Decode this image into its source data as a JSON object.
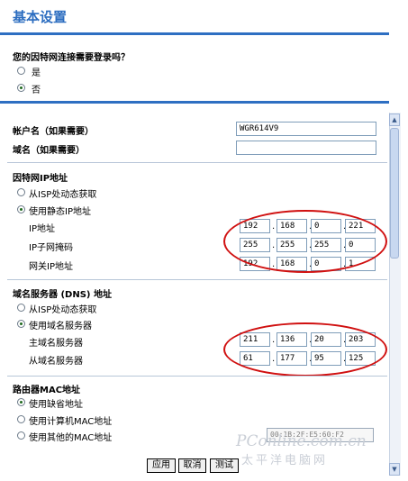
{
  "page": {
    "title": "基本设置"
  },
  "login": {
    "question": "您的因特网连接需要登录吗？",
    "yes": "是",
    "no": "否"
  },
  "account": {
    "account_label": "帐户名（如果需要）",
    "account_value": "WGR614V9",
    "domain_label": "域名（如果需要）",
    "domain_value": ""
  },
  "ip": {
    "section": "因特网IP地址",
    "dynamic": "从ISP处动态获取",
    "static": "使用静态IP地址",
    "addr_label": "IP地址",
    "mask_label": "IP子网掩码",
    "gw_label": "网关IP地址",
    "addr": [
      "192",
      "168",
      "0",
      "221"
    ],
    "mask": [
      "255",
      "255",
      "255",
      "0"
    ],
    "gw": [
      "192",
      "168",
      "0",
      "1"
    ]
  },
  "dns": {
    "section": "域名服务器 (DNS) 地址",
    "dynamic": "从ISP处动态获取",
    "use": "使用域名服务器",
    "primary_label": "主域名服务器",
    "secondary_label": "从域名服务器",
    "primary": [
      "211",
      "136",
      "20",
      "203"
    ],
    "secondary": [
      "61",
      "177",
      "95",
      "125"
    ]
  },
  "mac": {
    "section": "路由器MAC地址",
    "default": "使用缺省地址",
    "computer": "使用计算机MAC地址",
    "other": "使用其他的MAC地址",
    "value": "00:1B:2F:E5:60:F2"
  },
  "buttons": {
    "apply": "应用",
    "cancel": "取消",
    "test": "测试"
  },
  "watermark": {
    "brand": "PConline.com.cn",
    "cn": "太平洋电脑网"
  },
  "colors": {
    "accent": "#2e6fc2",
    "annotation": "#d01010"
  }
}
